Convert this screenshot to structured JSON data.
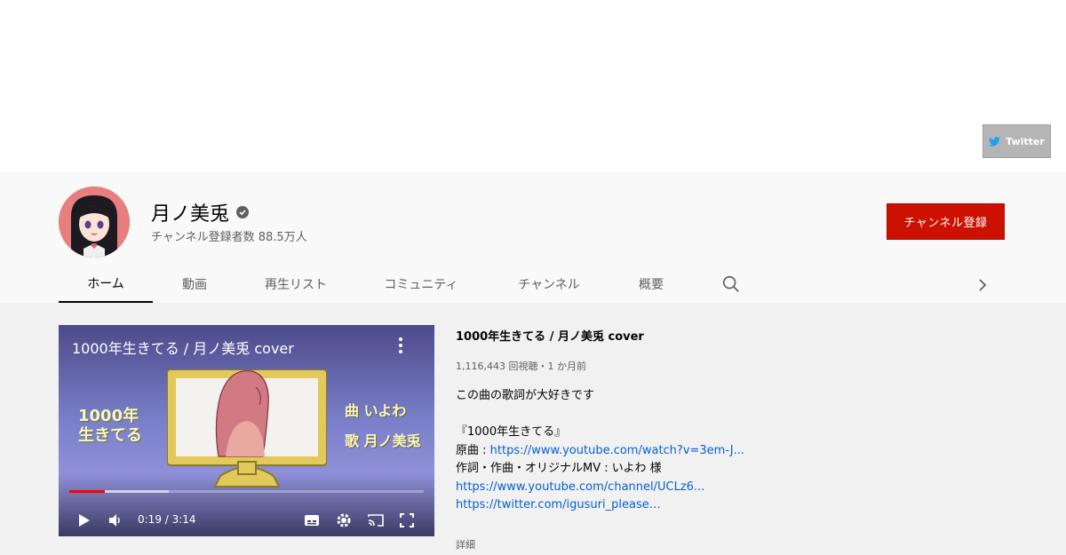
{
  "banner": {
    "twitter_label": "Twitter"
  },
  "channel": {
    "name": "月ノ美兎",
    "subscribers": "チャンネル登録者数 88.5万人",
    "subscribe_label": "チャンネル登録"
  },
  "tabs": [
    {
      "label": "ホーム",
      "active": true
    },
    {
      "label": "動画"
    },
    {
      "label": "再生リスト"
    },
    {
      "label": "コミュニティ"
    },
    {
      "label": "チャンネル"
    },
    {
      "label": "概要"
    }
  ],
  "player": {
    "title": "1000年生きてる / 月ノ美兎 cover",
    "time": "0:19 / 3:14",
    "progress_played": 0.1,
    "progress_buffered": 0.28,
    "art_left": [
      "1000年",
      "生きてる"
    ],
    "art_right": [
      "曲 いよわ",
      "歌 月ノ美兎"
    ]
  },
  "video": {
    "title": "1000年生きてる / 月ノ美兎 cover",
    "meta": "1,116,443 回視聴・1 か月前",
    "description": {
      "line1": "この曲の歌詞が大好きです",
      "line2": "『1000年生きてる』",
      "line3_label": "原曲 : ",
      "line3_link": "https://www.youtube.com/watch?v=3em-J...",
      "line4": "作詞・作曲・オリジナルMV : いよわ 様",
      "line5_link": "https://www.youtube.com/channel/UCLz6...",
      "line6_link": "https://twitter.com/igusuri_please…"
    },
    "more_label": "詳細"
  },
  "colors": {
    "subscribe": "#cc1100",
    "link": "#065fd4",
    "progress": "#ff0000"
  }
}
